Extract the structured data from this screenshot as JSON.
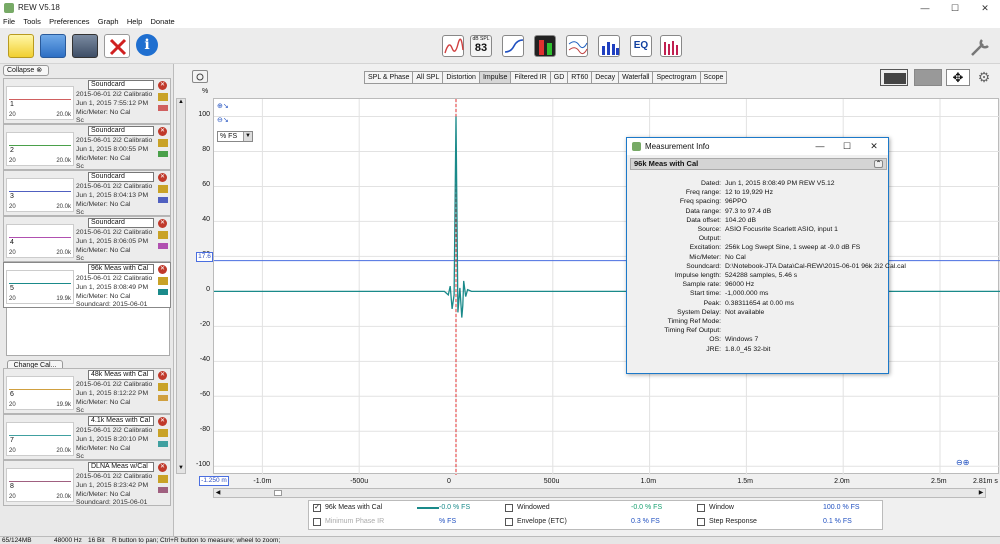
{
  "app": {
    "title": "REW V5.18"
  },
  "menu": [
    "File",
    "Tools",
    "Preferences",
    "Graph",
    "Help",
    "Donate"
  ],
  "toolbar": {
    "spl_meter_label": "dB SPL",
    "spl_meter_value": "83"
  },
  "sidebar": {
    "collapse_label": "Collapse",
    "change_cal_label": "Change Cal...",
    "measurements": [
      {
        "num": "1",
        "name": "Soundcard",
        "line1": "2015-06-01 2i2 Calibratio",
        "line2": "Jun 1, 2015 7:55:12 PM",
        "line3": "Mic/Meter: No Cal",
        "scale_lo": "20",
        "scale_hi": "20.0k",
        "extra": "Sc",
        "color": "#d06060"
      },
      {
        "num": "2",
        "name": "Soundcard",
        "line1": "2015-06-01 2i2 Calibratio",
        "line2": "Jun 1, 2015 8:00:55 PM",
        "line3": "Mic/Meter: No Cal",
        "scale_lo": "20",
        "scale_hi": "20.0k",
        "extra": "Sc",
        "color": "#4aa04a"
      },
      {
        "num": "3",
        "name": "Soundcard",
        "line1": "2015-06-01 2i2 Calibratio",
        "line2": "Jun 1, 2015 8:04:13 PM",
        "line3": "Mic/Meter: No Cal",
        "scale_lo": "20",
        "scale_hi": "20.0k",
        "extra": "Sc",
        "color": "#5060c0"
      },
      {
        "num": "4",
        "name": "Soundcard",
        "line1": "2015-06-01 2i2 Calibratio",
        "line2": "Jun 1, 2015 8:06:05 PM",
        "line3": "Mic/Meter: No Cal",
        "scale_lo": "20",
        "scale_hi": "20.0k",
        "extra": "Sc",
        "color": "#b050b0"
      },
      {
        "num": "5",
        "name": "96k Meas with Cal",
        "line1": "2015-06-01 2i2 Calibratio",
        "line2": "Jun 1, 2015 8:08:49 PM",
        "line3": "Mic/Meter: No Cal",
        "scale_lo": "20",
        "scale_hi": "19.9k",
        "extra": "Soundcard: 2015-06-01",
        "color": "#1a8a8a"
      },
      {
        "num": "6",
        "name": "48k Meas with Cal",
        "line1": "2015-06-01 2i2 Calibratio",
        "line2": "Jun 1, 2015 8:12:22 PM",
        "line3": "Mic/Meter: No Cal",
        "scale_lo": "20",
        "scale_hi": "19.9k",
        "extra": "Sc",
        "color": "#d0a040"
      },
      {
        "num": "7",
        "name": "4.1k Meas with Cal",
        "line1": "2015-06-01 2i2 Calibratio",
        "line2": "Jun 1, 2015 8:20:10 PM",
        "line3": "Mic/Meter: No Cal",
        "scale_lo": "20",
        "scale_hi": "20.0k",
        "extra": "Sc",
        "color": "#40a0a0"
      },
      {
        "num": "8",
        "name": "DLNA Meas w/Cal",
        "line1": "2015-06-01 2i2 Calibratio",
        "line2": "Jun 1, 2015 8:23:42 PM",
        "line3": "Mic/Meter: No Cal",
        "scale_lo": "20",
        "scale_hi": "20.0k",
        "extra": "Soundcard: 2015-06-01",
        "color": "#a06080"
      }
    ]
  },
  "graph_tabs": [
    "SPL & Phase",
    "All SPL",
    "Distortion",
    "Impulse",
    "Filtered IR",
    "GD",
    "RT60",
    "Decay",
    "Waterfall",
    "Spectrogram",
    "Scope"
  ],
  "active_tab": "Impulse",
  "plot": {
    "y_unit": "%",
    "scale_select": "% FS",
    "cursor_y": "17.6",
    "cursor_x": "-1.250 m"
  },
  "chart_data": {
    "type": "line",
    "title": "",
    "xlabel": "",
    "ylabel": "%",
    "x_unit": "s",
    "xlim": [
      -0.00125,
      0.00281
    ],
    "ylim": [
      -105,
      110
    ],
    "x_ticks": [
      {
        "v": -0.001,
        "label": "-1.0m"
      },
      {
        "v": -0.0005,
        "label": "-500u"
      },
      {
        "v": 0,
        "label": "0"
      },
      {
        "v": 0.0005,
        "label": "500u"
      },
      {
        "v": 0.001,
        "label": "1.0m"
      },
      {
        "v": 0.0015,
        "label": "1.5m"
      },
      {
        "v": 0.002,
        "label": "2.0m"
      },
      {
        "v": 0.0025,
        "label": "2.5m"
      },
      {
        "v": 0.00281,
        "label": "2.81m s"
      }
    ],
    "y_ticks": [
      100,
      80,
      60,
      40,
      20,
      0,
      -20,
      -40,
      -60,
      -80,
      -100
    ],
    "grid": true,
    "series": [
      {
        "color": "#1a8a8a",
        "points": [
          [
            -0.00125,
            0
          ],
          [
            -6e-05,
            0
          ],
          [
            -4e-05,
            -2
          ],
          [
            -3e-05,
            3
          ],
          [
            -2e-05,
            -10
          ],
          [
            -1e-05,
            -2
          ],
          [
            0,
            100
          ],
          [
            1e-05,
            -12
          ],
          [
            2e-05,
            2
          ],
          [
            3e-05,
            -15
          ],
          [
            3.5e-05,
            -8
          ],
          [
            4e-05,
            6
          ],
          [
            5e-05,
            -3
          ],
          [
            6e-05,
            1
          ],
          [
            8e-05,
            0
          ],
          [
            0.00281,
            0
          ]
        ]
      }
    ]
  },
  "legend": {
    "rows": [
      [
        {
          "label": "96k Meas with Cal",
          "checked": true,
          "value": "-0.0 % FS"
        },
        {
          "label": "Windowed",
          "checked": false,
          "value": "-0.0 % FS"
        },
        {
          "label": "Window",
          "checked": false,
          "value": "100.0 % FS"
        }
      ],
      [
        {
          "label": "Minimum Phase IR",
          "checked": false,
          "value": "% FS"
        },
        {
          "label": "Envelope (ETC)",
          "checked": false,
          "value": "0.3 % FS"
        },
        {
          "label": "Step Response",
          "checked": false,
          "value": "0.1 % FS"
        }
      ]
    ]
  },
  "status": {
    "memory": "65/124MB",
    "rate": "48000 Hz",
    "bits": "16 Bit",
    "hint": "R button to pan; Ctrl+R button to measure; wheel to zoom;"
  },
  "dialog": {
    "title": "Measurement Info",
    "header": "96k Meas with Cal",
    "fields": [
      {
        "k": "Dated:",
        "v": "Jun 1, 2015 8:08:49 PM REW V5.12"
      },
      {
        "k": "Freq range:",
        "v": "12 to 19,929 Hz"
      },
      {
        "k": "Freq spacing:",
        "v": "96PPO"
      },
      {
        "k": "Data range:",
        "v": "97.3 to 97.4 dB"
      },
      {
        "k": "Data offset:",
        "v": "104.20 dB"
      },
      {
        "k": "Source:",
        "v": "ASIO Focusrite Scarlett ASIO, input 1"
      },
      {
        "k": "Output:",
        "v": ""
      },
      {
        "k": "Excitation:",
        "v": "256k Log Swept Sine, 1 sweep at -9.0 dB FS"
      },
      {
        "k": "Mic/Meter:",
        "v": "No Cal"
      },
      {
        "k": "Soundcard:",
        "v": "D:\\Notebook-JTA Data\\Cal-REW\\2015-06-01 96k 2i2 Cal.cal"
      },
      {
        "k": "Impulse length:",
        "v": "524288 samples, 5.46 s"
      },
      {
        "k": "Sample rate:",
        "v": "96000 Hz"
      },
      {
        "k": "Start time:",
        "v": "-1,000.000 ms"
      },
      {
        "k": "Peak:",
        "v": "0.38311654 at 0.00 ms"
      },
      {
        "k": "System Delay:",
        "v": "Not available"
      },
      {
        "k": "Timing Ref Mode:",
        "v": ""
      },
      {
        "k": "Timing Ref Output:",
        "v": ""
      },
      {
        "k": "OS:",
        "v": "Windows 7"
      },
      {
        "k": "JRE:",
        "v": "1.8.0_45 32-bit"
      }
    ]
  }
}
